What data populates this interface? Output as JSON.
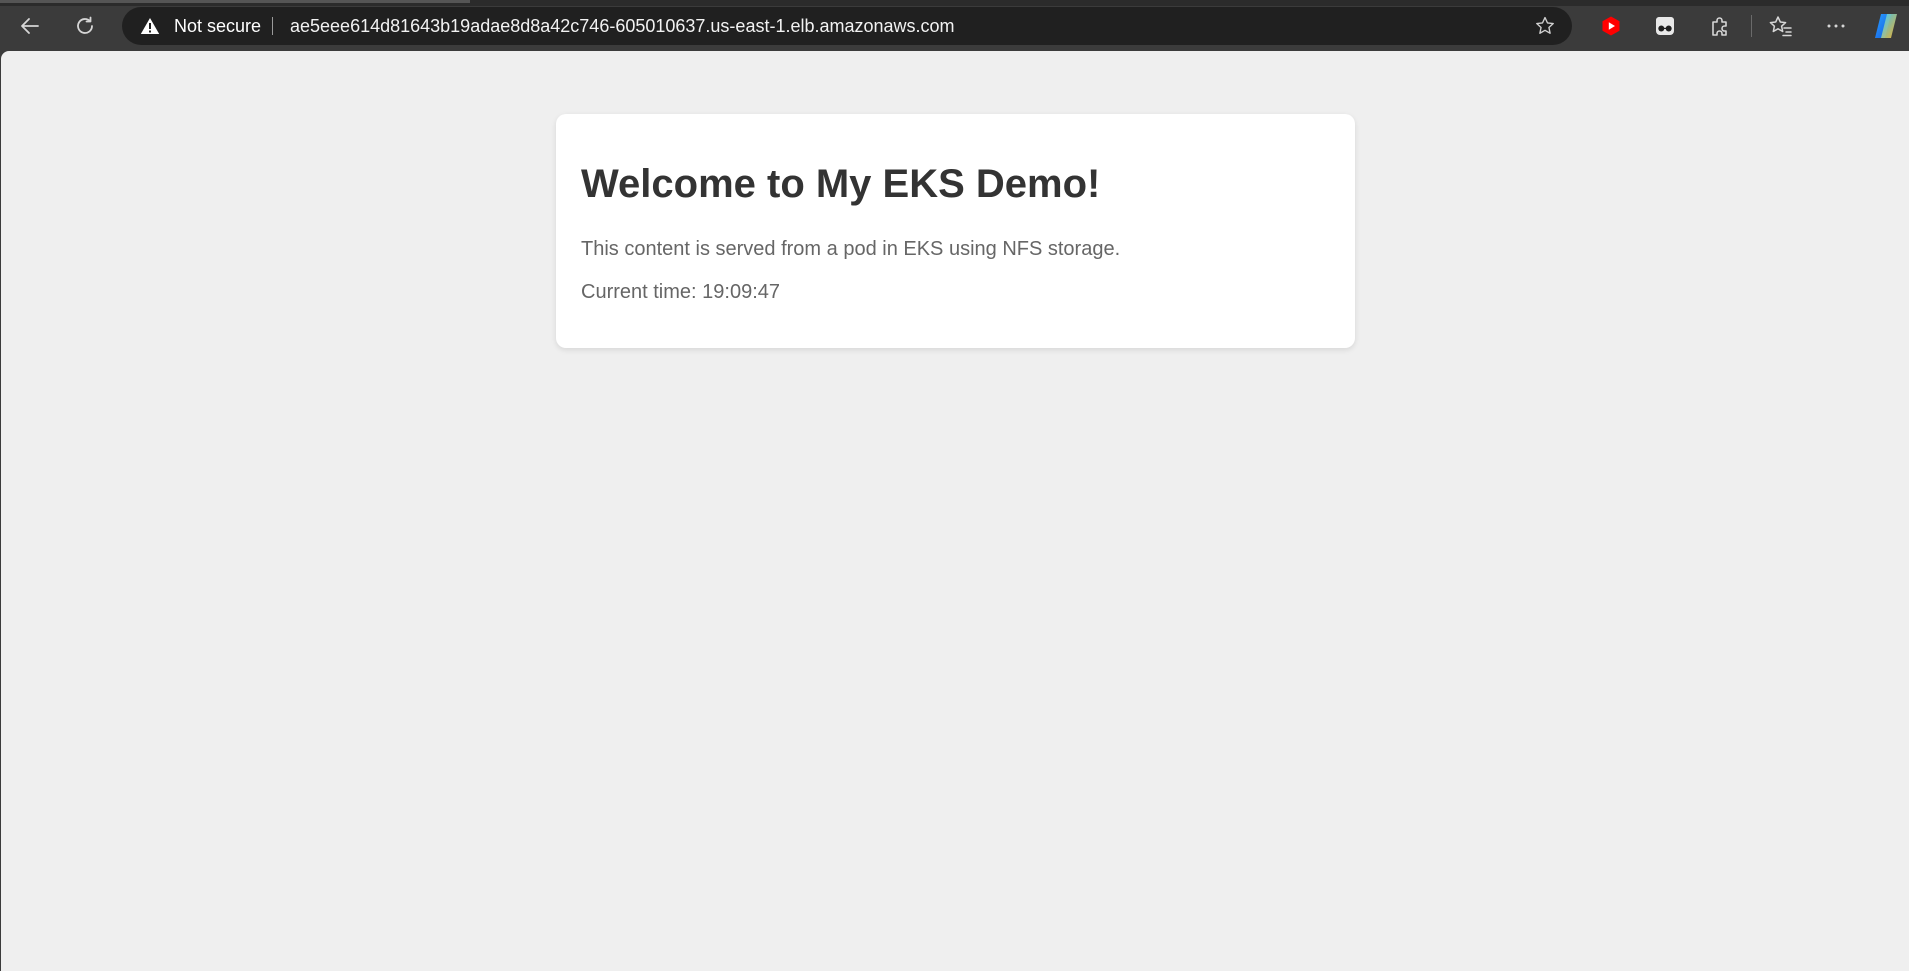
{
  "browser": {
    "security_label": "Not secure",
    "url": "ae5eee614d81643b19adae8d8a42c746-605010637.us-east-1.elb.amazonaws.com",
    "icons": {
      "back": "back-arrow-icon",
      "reload": "reload-icon",
      "security": "warning-triangle-icon",
      "favorite": "star-icon",
      "youtube_extension": "youtube-icon",
      "extension_2": "glasses-icon",
      "extensions": "puzzle-icon",
      "favorites": "favorites-star-icon",
      "menu": "more-dots-icon",
      "copilot": "copilot-icon"
    },
    "colors": {
      "toolbar_bg": "#3b3b3b",
      "address_bg": "#202020",
      "youtube_red": "#ff0000"
    }
  },
  "page": {
    "heading": "Welcome to My EKS Demo!",
    "description": "This content is served from a pod in EKS using NFS storage.",
    "current_time": "Current time: 19:09:47",
    "colors": {
      "background": "#efefef",
      "card": "#ffffff",
      "heading": "#333333",
      "text": "#666666"
    }
  }
}
